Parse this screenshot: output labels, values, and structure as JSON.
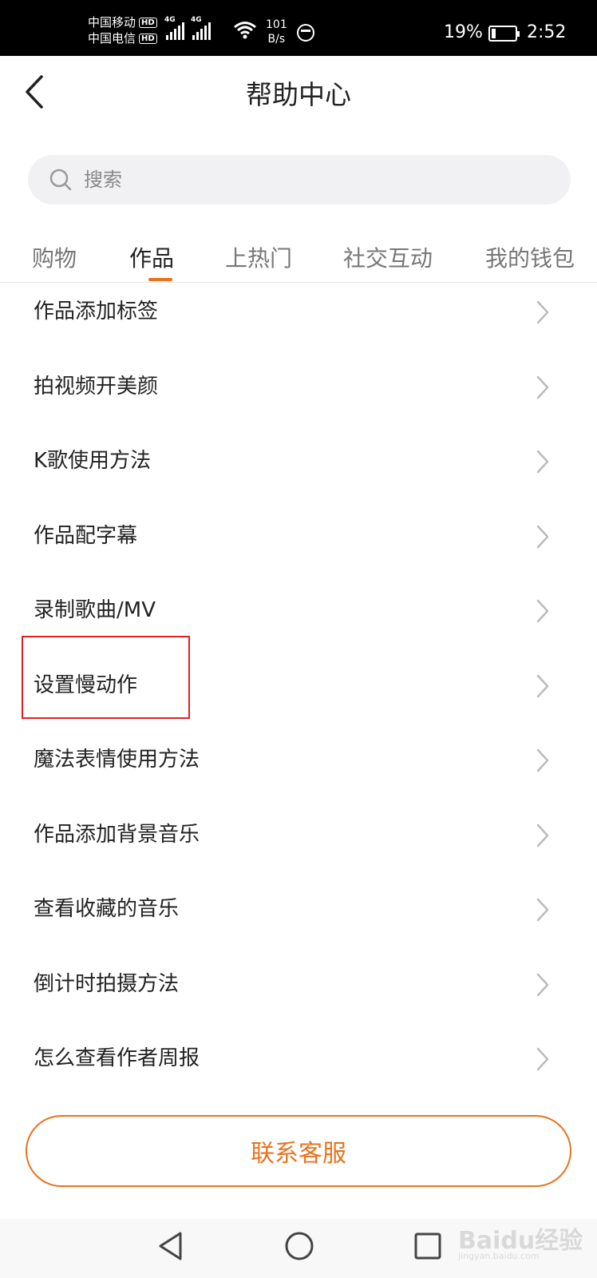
{
  "status_bar": {
    "carrier1": "中国移动",
    "carrier2": "中国电信",
    "hd": "HD",
    "net1": "4G",
    "net2": "4G",
    "speed_value": "101",
    "speed_unit": "B/s",
    "battery_percent": "19%",
    "battery_level": 0.19,
    "time": "2:52"
  },
  "header": {
    "title": "帮助中心"
  },
  "search": {
    "placeholder": "搜索"
  },
  "tabs": [
    {
      "label": "购物",
      "active": false
    },
    {
      "label": "作品",
      "active": true
    },
    {
      "label": "上热门",
      "active": false
    },
    {
      "label": "社交互动",
      "active": false
    },
    {
      "label": "我的钱包",
      "active": false
    }
  ],
  "list": {
    "items": [
      "作品添加标签",
      "拍视频开美颜",
      "K歌使用方法",
      "作品配字幕",
      "录制歌曲/MV",
      "设置慢动作",
      "魔法表情使用方法",
      "作品添加背景音乐",
      "查看收藏的音乐",
      "倒计时拍摄方法",
      "怎么查看作者周报"
    ]
  },
  "contact": {
    "label": "联系客服"
  },
  "colors": {
    "accent": "#e9731e",
    "highlight": "#e02020"
  },
  "watermark": {
    "main": "Baidu经验",
    "sub": "jingyan.baidu.com"
  }
}
